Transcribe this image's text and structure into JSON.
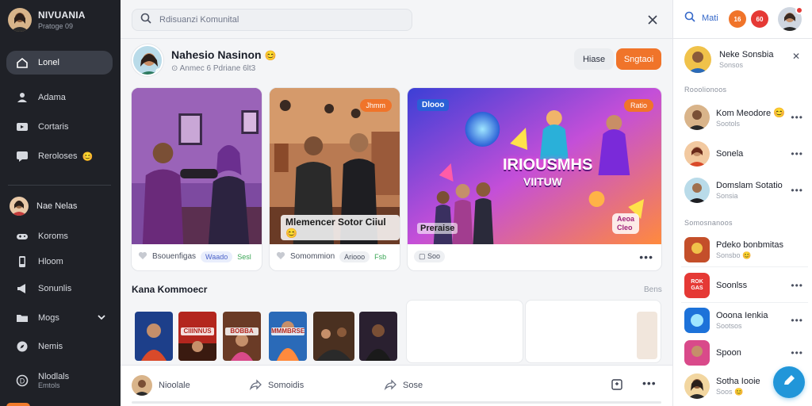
{
  "sidebar": {
    "brand_title": "NIVUANIA",
    "brand_sub": "Pratoge 09",
    "items": [
      {
        "label": "Lonel",
        "icon": "home-icon",
        "active": true
      },
      {
        "label": "Adama",
        "icon": "user-icon"
      },
      {
        "label": "Cortaris",
        "icon": "tv-icon"
      },
      {
        "label": "Reroloses",
        "icon": "chat-icon",
        "emoji": "😊"
      }
    ],
    "profile_name": "Nae Nelas",
    "items2": [
      {
        "label": "Koroms",
        "icon": "gamepad-icon"
      },
      {
        "label": "Hloom",
        "icon": "phone-icon"
      },
      {
        "label": "Sonunlis",
        "icon": "megaphone-icon"
      },
      {
        "label": "Mogs",
        "icon": "folder-icon",
        "has_chevron": true
      },
      {
        "label": "Nemis",
        "icon": "compass-icon"
      }
    ],
    "bottom_title": "Nlodlals",
    "bottom_sub": "Emtols"
  },
  "search": {
    "placeholder": "Rdisuanzi Komunital"
  },
  "profile": {
    "name": "Nahesio Nasinon",
    "emoji": "😊",
    "meta": "Anmec 6 Pdriane 6lt3"
  },
  "header_buttons": {
    "ghost": "Hiase",
    "primary": "Sngtaoi"
  },
  "cards": [
    {
      "caption": "",
      "tag": "",
      "foot_text": "Bsouenfigas",
      "chip": "Waado",
      "green": "Sesl"
    },
    {
      "caption": "Mlemencer Sotor Ciiul",
      "caption_emoji": "😊",
      "tag": "Jhmm",
      "foot_text": "Somommion",
      "chip": "Ariooo",
      "green": "Fsb"
    },
    {
      "tag": "Ratio",
      "title_badge": "Dlooo",
      "banner_title": "IRIOUSMHS",
      "banner_sub": "VIITUW",
      "bottom_left": "Preraise",
      "bottom_right_1": "Aeoa",
      "bottom_right_2": "Cleo",
      "foot_text": "Soo"
    }
  ],
  "section": {
    "title": "Kana Kommoecr",
    "more": "Bens"
  },
  "thumbs": [
    {
      "label": ""
    },
    {
      "label": "CIIINNUS"
    },
    {
      "label": "BOBBA"
    },
    {
      "label": "MMMBRSE"
    },
    {
      "label": ""
    },
    {
      "label": ""
    }
  ],
  "bottom_bar": {
    "name": "Nioolale",
    "share": "Somoidis",
    "save": "Sose"
  },
  "right": {
    "search_label": "Mati",
    "badge1": "16",
    "badge2": "60",
    "header_name": "Neke Sonsbia",
    "header_sub": "Sonsos",
    "label1": "Rooolionoos",
    "people": [
      {
        "name": "Kom Meodore",
        "sub": "Sootols",
        "emoji": "😊"
      },
      {
        "name": "Sonela",
        "sub": ""
      },
      {
        "name": "Domslam Sotatio",
        "sub": "Sonsia"
      }
    ],
    "label2": "Somosnanoos",
    "groups": [
      {
        "name": "Pdeko bonbmitas",
        "sub": "Sonsbo",
        "emoji": "😊"
      },
      {
        "name": "Soonlss",
        "sub": "",
        "sq_text": "ROK GAS"
      },
      {
        "name": "Ooona Ienkia",
        "sub": "Sootsos"
      },
      {
        "name": "Spoon",
        "sub": ""
      },
      {
        "name": "Sotha Iooie",
        "sub": "Soos",
        "emoji": "😊"
      }
    ]
  },
  "colors": {
    "accent": "#f0742a",
    "sidebar_bg": "#1f2127",
    "link": "#3568c9",
    "fab": "#2196d9"
  }
}
